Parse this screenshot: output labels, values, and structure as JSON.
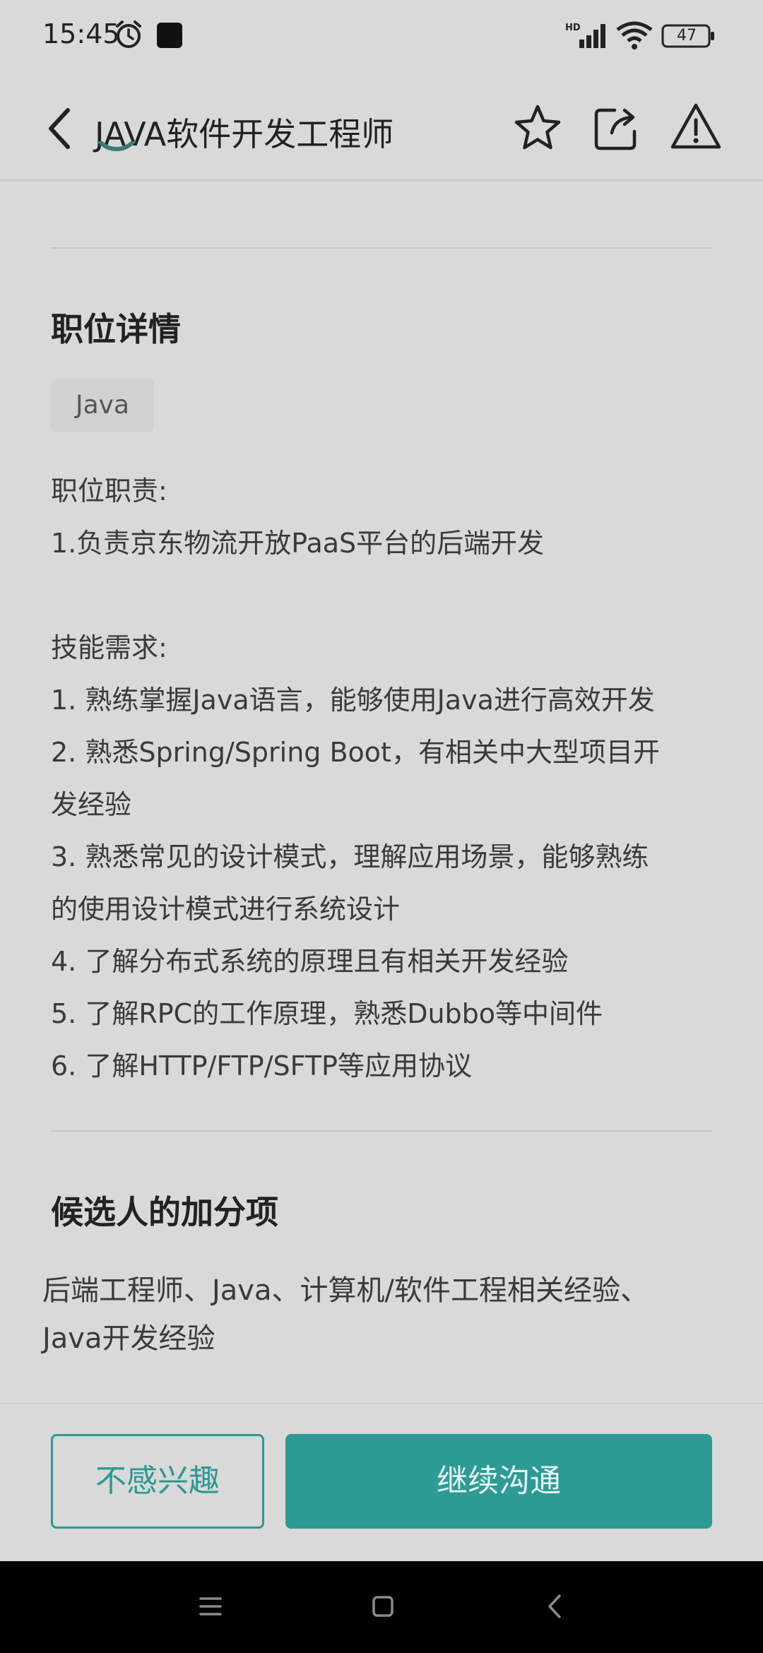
{
  "status_bar": {
    "time": "15:45",
    "battery": "47",
    "network_label": "HD"
  },
  "header": {
    "title": "JAVA软件开发工程师",
    "icons": [
      "back-icon",
      "star-icon",
      "share-icon",
      "report-icon"
    ]
  },
  "job_details": {
    "section_title": "职位详情",
    "tag": "Java",
    "lines": [
      "职位职责:",
      "1.负责京东物流开放PaaS平台的后端开发",
      "技能需求:",
      "1. 熟练掌握Java语言，能够使用Java进行高效开发",
      "2. 熟悉Spring/Spring Boot，有相关中大型项目开",
      "发经验",
      "3. 熟悉常见的设计模式，理解应用场景，能够熟练",
      "的使用设计模式进行系统设计",
      "4. 了解分布式系统的原理且有相关开发经验",
      "5. 了解RPC的工作原理，熟悉Dubbo等中间件",
      "6. 了解HTTP/FTP/SFTP等应用协议"
    ]
  },
  "bonus": {
    "section_title": "候选人的加分项",
    "lines": [
      "后端工程师、Java、计算机/软件工程相关经验、",
      "Java开发经验"
    ]
  },
  "actions": {
    "not_interested": "不感兴趣",
    "continue_chat": "继续沟通"
  },
  "colors": {
    "accent": "#2c9b94",
    "background": "#d9d9d9"
  }
}
